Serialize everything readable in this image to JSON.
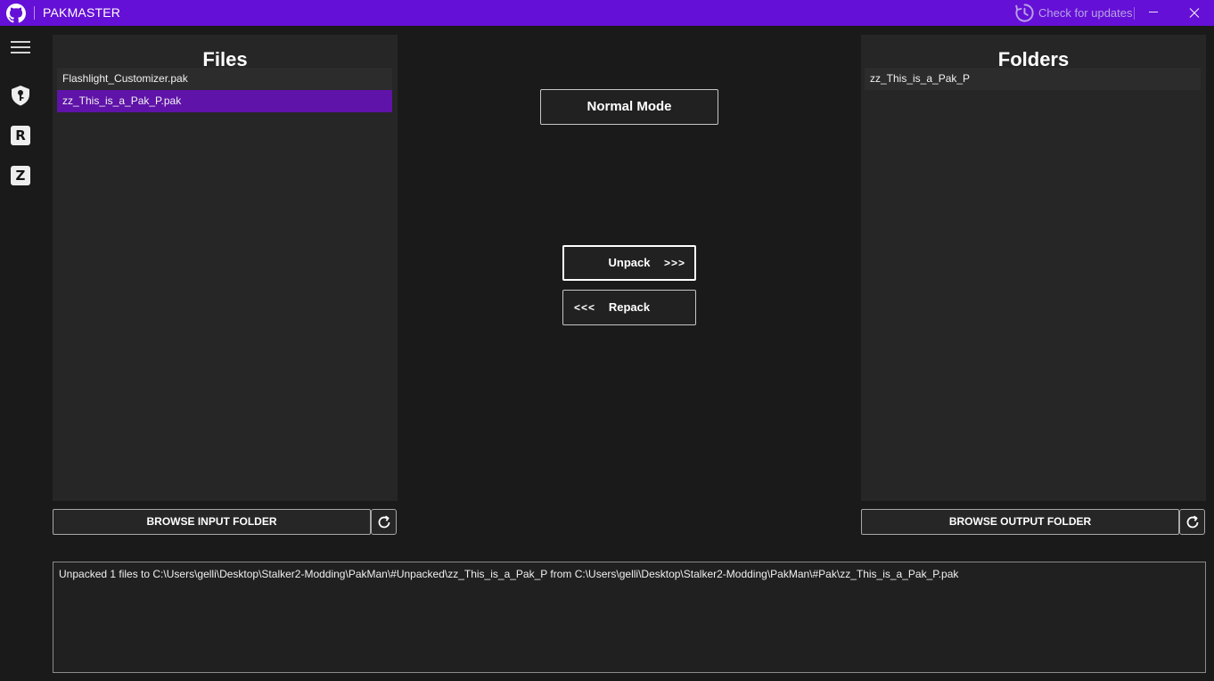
{
  "window": {
    "title": "PAKMASTER",
    "check_updates_label": "Check for updates",
    "accent_color": "#6510d6"
  },
  "sidebar": {
    "items": [
      {
        "name": "menu",
        "icon": "hamburger-icon"
      },
      {
        "name": "key",
        "icon": "key-shield-icon"
      },
      {
        "name": "r-mode",
        "label": "R"
      },
      {
        "name": "z-mode",
        "label": "Z"
      }
    ]
  },
  "files_panel": {
    "title": "Files",
    "items": [
      {
        "label": "Flashlight_Customizer.pak",
        "selected": false
      },
      {
        "label": "zz_This_is_a_Pak_P.pak",
        "selected": true
      }
    ],
    "browse_label": "BROWSE INPUT FOLDER"
  },
  "folders_panel": {
    "title": "Folders",
    "items": [
      {
        "label": "zz_This_is_a_Pak_P",
        "selected": false
      }
    ],
    "browse_label": "BROWSE OUTPUT FOLDER"
  },
  "actions": {
    "mode_label": "Normal Mode",
    "unpack_label": "Unpack",
    "unpack_arrows": ">>>",
    "repack_label": "Repack",
    "repack_arrows": "<<<"
  },
  "log": {
    "text": "Unpacked 1 files to C:\\Users\\gelli\\Desktop\\Stalker2-Modding\\PakMan\\#Unpacked\\zz_This_is_a_Pak_P from C:\\Users\\gelli\\Desktop\\Stalker2-Modding\\PakMan\\#Pak\\zz_This_is_a_Pak_P.pak"
  },
  "colors": {
    "selected_row": "#5f13a8",
    "panel_bg": "#262626",
    "window_bg": "#1a1a1a"
  }
}
